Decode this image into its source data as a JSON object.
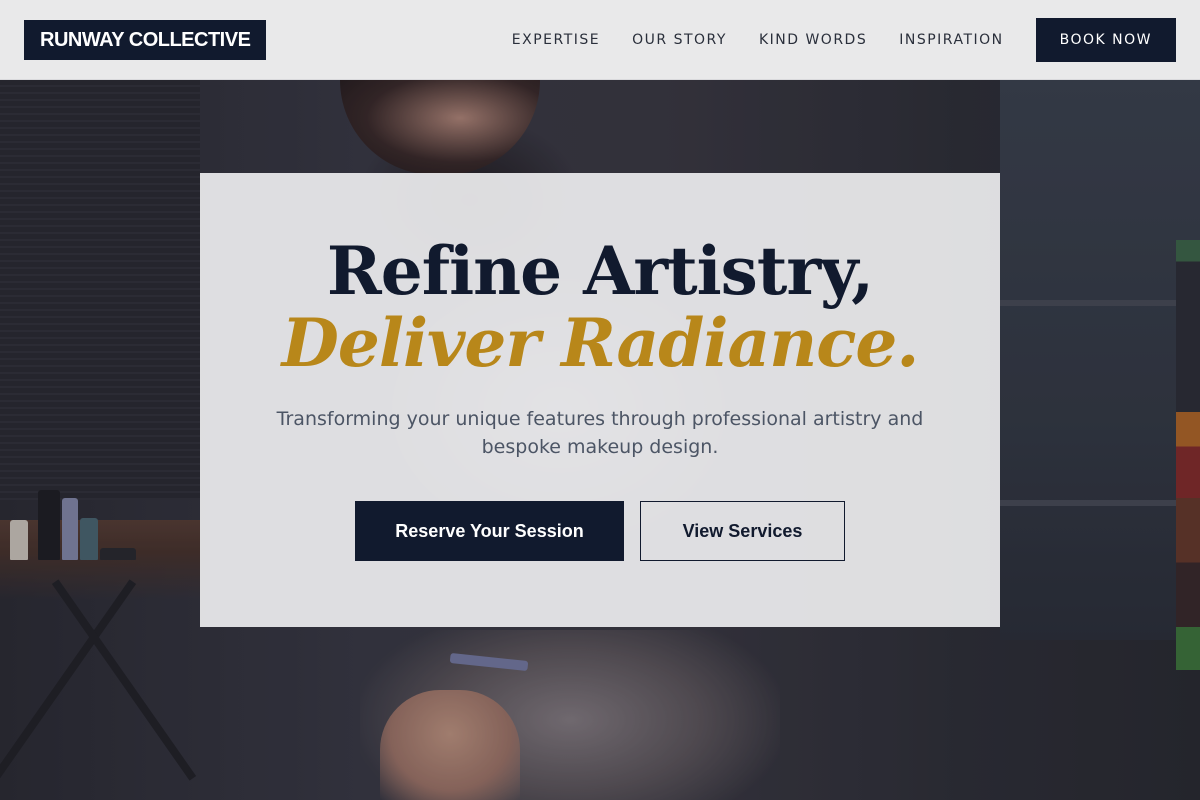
{
  "header": {
    "logo": "RUNWAY COLLECTIVE",
    "nav": [
      {
        "label": "EXPERTISE"
      },
      {
        "label": "OUR STORY"
      },
      {
        "label": "KIND WORDS"
      },
      {
        "label": "INSPIRATION"
      }
    ],
    "cta_label": "BOOK NOW"
  },
  "hero": {
    "headline": "Refine Artistry,",
    "headline_accent": "Deliver Radiance.",
    "subtitle": "Transforming your unique features through professional artistry and bespoke makeup design.",
    "primary_button": "Reserve Your Session",
    "secondary_button": "View Services"
  },
  "colors": {
    "brand_navy": "#111a2e",
    "accent_gold": "#b8871a",
    "header_bg": "#e9e9ea"
  }
}
